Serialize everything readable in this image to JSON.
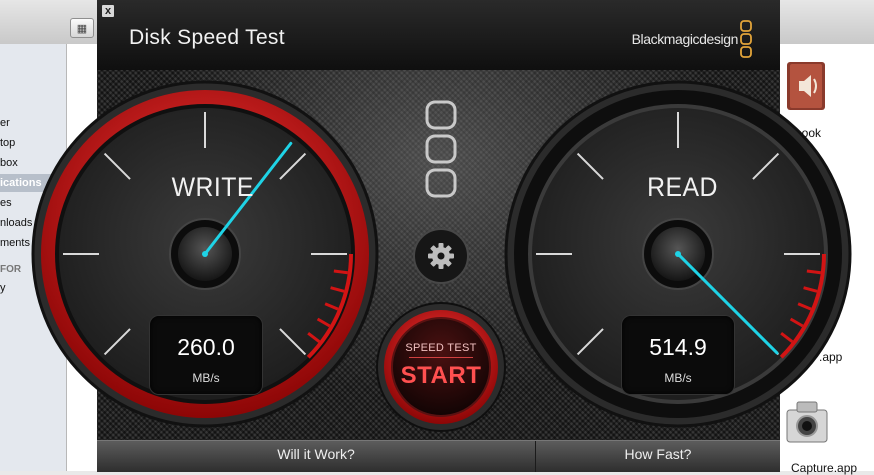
{
  "finder": {
    "sidebar_items": [
      "er",
      "top",
      "box",
      "ications",
      "es",
      "nloads",
      "ments",
      "FOR",
      "y"
    ],
    "apps": [
      "book",
      ".app",
      ".app",
      "Capture.app"
    ]
  },
  "window": {
    "close_label": "x",
    "title": "Disk Speed Test",
    "brand": "Blackmagicdesign"
  },
  "write_gauge": {
    "label": "WRITE",
    "value": "260.0",
    "unit": "MB/s",
    "needle_value": 0.64
  },
  "read_gauge": {
    "label": "READ",
    "value": "514.9",
    "unit": "MB/s",
    "needle_value": 1.0
  },
  "start_button": {
    "small_label": "SPEED TEST",
    "big_label": "START"
  },
  "footer": {
    "will_it_work": "Will it Work?",
    "how_fast": "How Fast?"
  },
  "colors": {
    "accent_red": "#d21414",
    "needle_cyan": "#1fd3e6"
  }
}
